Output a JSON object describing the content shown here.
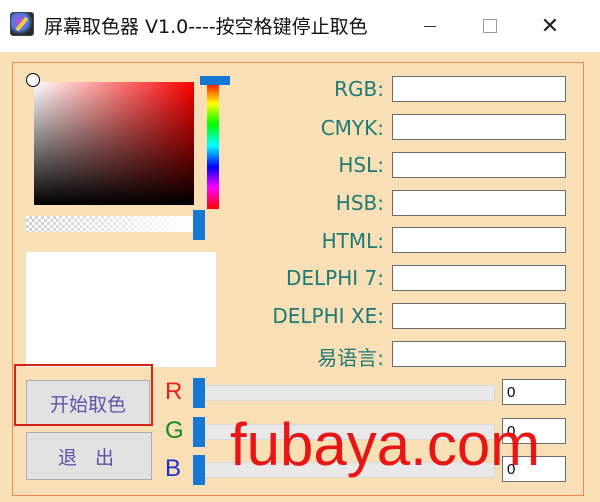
{
  "window": {
    "title": "屏幕取色器 V1.0----按空格键停止取色",
    "close_glyph": "✕"
  },
  "fields": [
    {
      "label": "RGB:",
      "value": ""
    },
    {
      "label": "CMYK:",
      "value": ""
    },
    {
      "label": "HSL:",
      "value": ""
    },
    {
      "label": "HSB:",
      "value": ""
    },
    {
      "label": "HTML:",
      "value": ""
    },
    {
      "label": "DELPHI 7:",
      "value": ""
    },
    {
      "label": "DELPHI XE:",
      "value": ""
    },
    {
      "label": "易语言:",
      "value": ""
    }
  ],
  "buttons": {
    "start_label": "开始取色",
    "exit_label": "退 出"
  },
  "sliders": [
    {
      "label": "R",
      "value": "0",
      "color": "#e8231b"
    },
    {
      "label": "G",
      "value": "0",
      "color": "#1a8a1a"
    },
    {
      "label": "B",
      "value": "0",
      "color": "#1b2fd8"
    }
  ],
  "colors": {
    "background": "#f8dfb5",
    "label_color": "#1d7a74",
    "accent_blue": "#1777d4",
    "highlight_red": "#d6221d"
  },
  "watermark": "fubaya.com"
}
